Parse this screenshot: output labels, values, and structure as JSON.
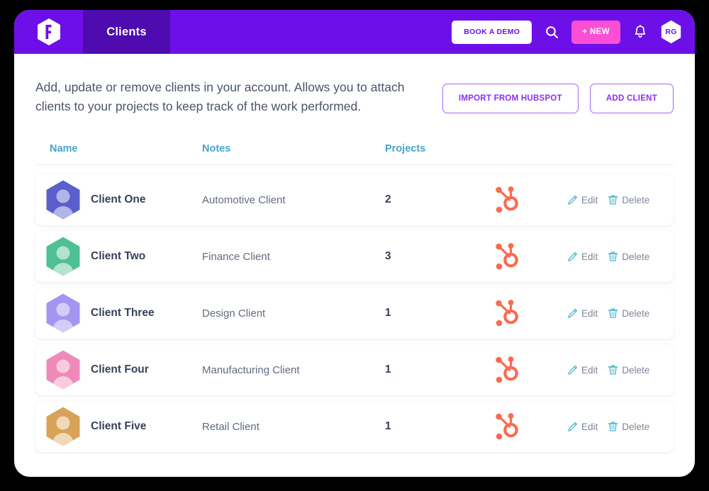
{
  "header": {
    "logo_icon": "flowlens-hex-logo",
    "tab_label": "Clients",
    "demo_button": "BOOK A DEMO",
    "search_icon": "search-icon",
    "new_button": "+ NEW",
    "bell_icon": "bell-icon",
    "avatar_initials": "RG",
    "bg_color": "#6d10e8",
    "tab_bg_color": "#4d0bb0",
    "new_button_color": "#fc4fd4"
  },
  "intro": {
    "description": "Add, update or remove clients in your account. Allows you to attach clients to your projects to keep track of the work performed.",
    "import_button": "IMPORT FROM HUBSPOT",
    "add_button": "ADD CLIENT",
    "outline_color": "#a965f5",
    "outline_text_color": "#8b2ff0"
  },
  "table": {
    "header_color": "#47a5c9",
    "columns": [
      "Name",
      "Notes",
      "Projects"
    ],
    "edit_label": "Edit",
    "delete_label": "Delete",
    "hubspot_icon": "hubspot-sprocket-icon",
    "edit_icon": "pencil-icon",
    "delete_icon": "trash-icon",
    "rows": [
      {
        "name": "Client One",
        "notes": "Automotive Client",
        "projects": "2",
        "avatar_color": "#5b5fcc",
        "avatar_inner_color": "#b3b5e6"
      },
      {
        "name": "Client Two",
        "notes": "Finance Client",
        "projects": "3",
        "avatar_color": "#4fbf94",
        "avatar_inner_color": "#b4e3cf"
      },
      {
        "name": "Client Three",
        "notes": "Design Client",
        "projects": "1",
        "avatar_color": "#a396f0",
        "avatar_inner_color": "#d3cdf8"
      },
      {
        "name": "Client Four",
        "notes": "Manufacturing Client",
        "projects": "1",
        "avatar_color": "#ee8ab9",
        "avatar_inner_color": "#f8cbde"
      },
      {
        "name": "Client Five",
        "notes": "Retail Client",
        "projects": "1",
        "avatar_color": "#d8a259",
        "avatar_inner_color": "#f0d9b9"
      }
    ]
  }
}
